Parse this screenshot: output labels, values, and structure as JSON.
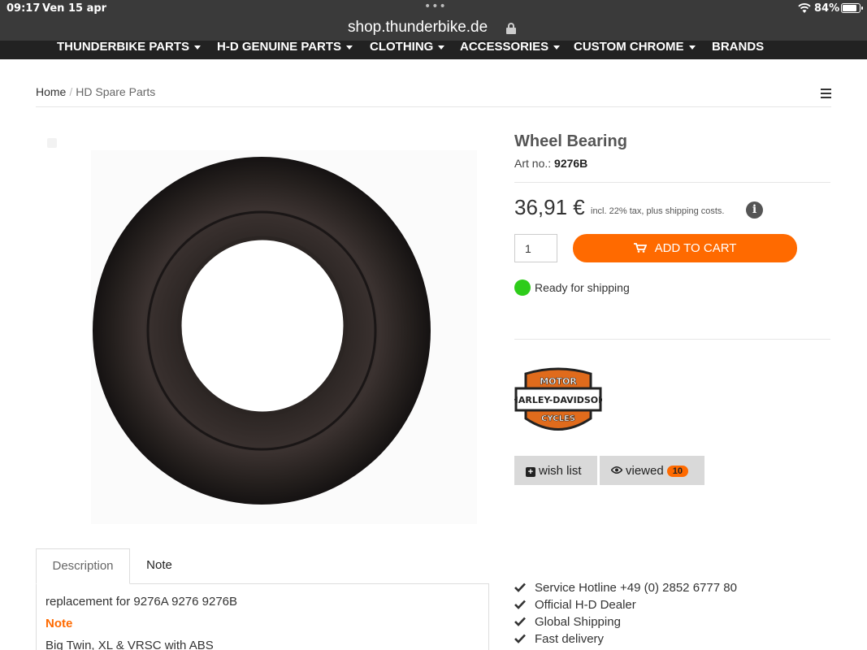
{
  "status_bar": {
    "time": "09:17",
    "date": "Ven 15 apr",
    "battery": "84%",
    "battery_level": 0.84
  },
  "browser": {
    "url": "shop.thunderbike.de"
  },
  "nav": {
    "items": [
      {
        "label": "THUNDERBIKE PARTS",
        "dropdown": true
      },
      {
        "label": "H-D GENUINE PARTS",
        "dropdown": true
      },
      {
        "label": "CLOTHING",
        "dropdown": true
      },
      {
        "label": "ACCESSORIES",
        "dropdown": true
      },
      {
        "label": "CUSTOM CHROME",
        "dropdown": true
      },
      {
        "label": "BRANDS",
        "dropdown": false
      }
    ]
  },
  "breadcrumb": {
    "home": "Home",
    "separator": "/",
    "current": "HD Spare Parts"
  },
  "product": {
    "title": "Wheel Bearing",
    "art_no_label": "Art no.:",
    "art_no": "9276B",
    "price": "36,91 €",
    "tax_note": "incl. 22% tax, plus shipping costs.",
    "quantity": "1",
    "add_to_cart": "ADD TO CART",
    "shipping_status": "Ready for shipping",
    "shipping_color": "#2ecc1a",
    "brand_logo": "harley-davidson-logo"
  },
  "actions": {
    "wish_list": "wish list",
    "viewed": "viewed",
    "viewed_count": "10"
  },
  "tabs": [
    {
      "label": "Description",
      "active": true
    },
    {
      "label": "Note",
      "active": false
    }
  ],
  "description": {
    "text": "replacement for 9276A 9276 9276B",
    "note_heading": "Note",
    "models": "Big Twin, XL & VRSC with ABS"
  },
  "benefits": [
    "Service Hotline +49 (0) 2852 6777 80",
    "Official H-D Dealer",
    "Global Shipping",
    "Fast delivery"
  ],
  "colors": {
    "accent": "#ff6a00",
    "nav_bg": "#222222",
    "status_bg": "#3a3a3a"
  }
}
